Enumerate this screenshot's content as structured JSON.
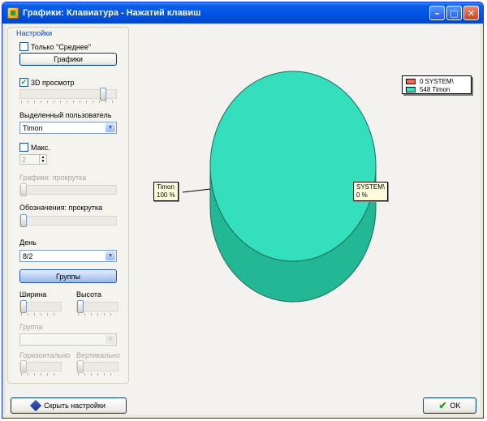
{
  "window": {
    "title": "Графики: Клавиатура - Нажатий клавиш",
    "controls": [
      "minimize",
      "maximize",
      "close"
    ]
  },
  "settings": {
    "group_title": "Настройки",
    "only_average": {
      "label": "Только \"Среднее\"",
      "checked": false
    },
    "graphs_button": "Графики",
    "view_3d": {
      "label": "3D просмотр",
      "checked": true,
      "level": 0.85
    },
    "selected_user": {
      "label": "Выделенный пользователь",
      "value": "Timon"
    },
    "max": {
      "label": "Макс.",
      "checked": false,
      "value": "2"
    },
    "graphs_scroll": {
      "label": "Графики: прокрутка",
      "enabled": false,
      "level": 0
    },
    "legend_scroll": {
      "label": "Обозначения: прокрутка",
      "enabled": true,
      "level": 0
    },
    "day": {
      "label": "День",
      "value": "8/2"
    },
    "groups_button": "Группы",
    "width": {
      "label": "Ширина"
    },
    "height": {
      "label": "Высота"
    },
    "group": {
      "label": "Группа",
      "value": ""
    },
    "horizontal": {
      "label": "Горизонтально"
    },
    "vertical": {
      "label": "Вертикально"
    }
  },
  "footer": {
    "hide_settings_button": "Скрыть настройки",
    "ok_button": "OK"
  },
  "chart_data": {
    "type": "pie",
    "view": "3d",
    "categories": [
      "SYSTEM\\",
      "Timon"
    ],
    "values": [
      0,
      548
    ],
    "legend": [
      "0 SYSTEM\\",
      "548 Timon"
    ],
    "legend_position": "top-right",
    "callouts": [
      {
        "name": "Timon",
        "percent": "100 %"
      },
      {
        "name": "SYSTEM\\",
        "percent": "0 %"
      }
    ],
    "colors": {
      "SYSTEM\\": "#f06a52",
      "Timon": "#33dfbd",
      "Timon_side": "#22b896"
    }
  }
}
